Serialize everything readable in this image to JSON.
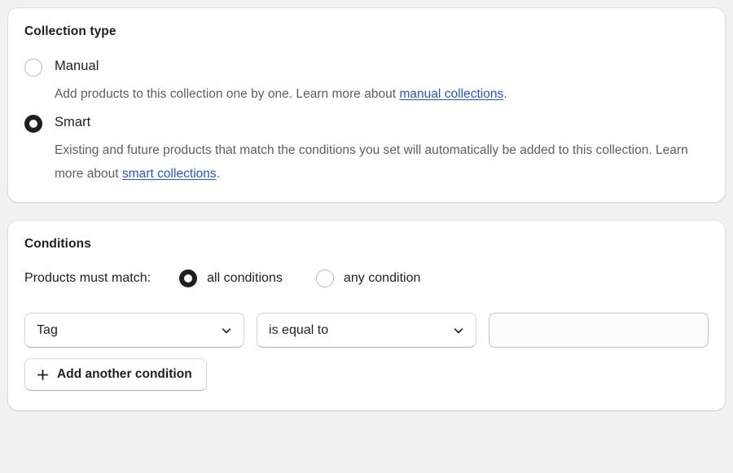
{
  "collection_type": {
    "heading": "Collection type",
    "options": [
      {
        "label": "Manual",
        "selected": false,
        "description_before": "Add products to this collection one by one. Learn more about ",
        "link_text": "manual collections",
        "description_after": "."
      },
      {
        "label": "Smart",
        "selected": true,
        "description_before": "Existing and future products that match the conditions you set will automatically be added to this collection. Learn more about ",
        "link_text": "smart collections",
        "description_after": "."
      }
    ]
  },
  "conditions": {
    "heading": "Conditions",
    "match_label": "Products must match:",
    "match_options": [
      {
        "label": "all conditions",
        "selected": true
      },
      {
        "label": "any condition",
        "selected": false
      }
    ],
    "rows": [
      {
        "field_value": "Tag",
        "operator_value": "is equal to",
        "value_text": "",
        "value_placeholder": ""
      }
    ],
    "add_button_label": "Add another condition",
    "add_button_icon": "plus-icon",
    "select_icon": "chevron-down-icon"
  },
  "colors": {
    "page_background": "#f1f1f1",
    "card_background": "#ffffff",
    "link": "#2457d6",
    "text_primary": "#1f1f1f",
    "text_secondary": "#5e5e5e",
    "radio_selected": "#1f1f1f",
    "border": "#d4d4d4"
  }
}
